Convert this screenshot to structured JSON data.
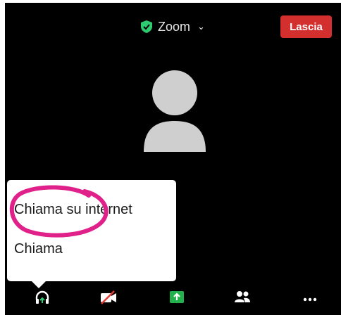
{
  "header": {
    "title": "Zoom",
    "leave_label": "Lascia"
  },
  "audio_menu": {
    "items": [
      {
        "label": "Chiama su internet"
      },
      {
        "label": "Chiama"
      }
    ]
  },
  "toolbar": {
    "buttons": [
      {
        "icon": "headphones-icon"
      },
      {
        "icon": "video-off-icon"
      },
      {
        "icon": "share-screen-icon"
      },
      {
        "icon": "participants-icon"
      },
      {
        "icon": "more-icon"
      }
    ]
  },
  "colors": {
    "background": "#000000",
    "leave": "#d32f2f",
    "shield": "#2ecc71",
    "share": "#22b14c",
    "annotation": "#e0218a",
    "avatar": "#cfcfcf"
  }
}
